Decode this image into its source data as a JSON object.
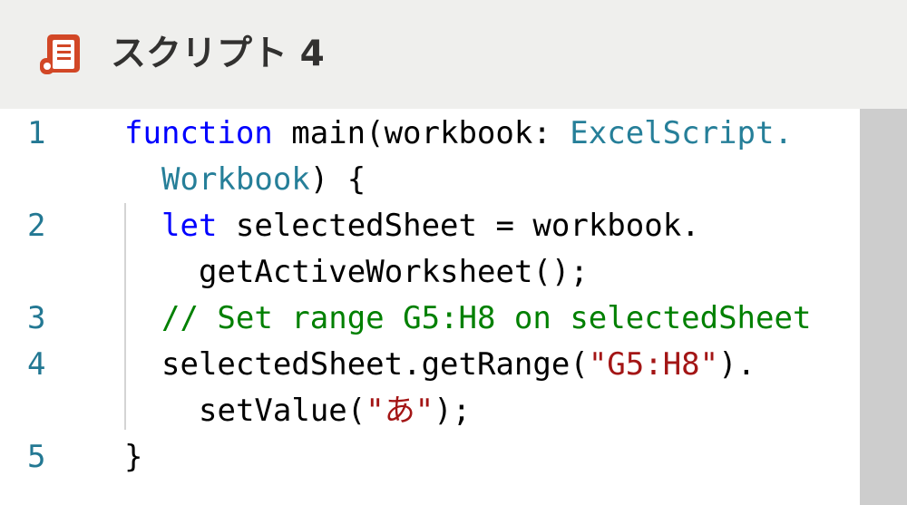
{
  "header": {
    "icon": "script-icon",
    "title": "スクリプト 4"
  },
  "colors": {
    "header_bg": "#efefed",
    "icon_orange": "#d24726",
    "keyword": "#0000ff",
    "type": "#267f99",
    "string": "#a31515",
    "comment": "#008000",
    "line_number": "#237893"
  },
  "editor": {
    "line_numbers": [
      "1",
      "2",
      "3",
      "4",
      "5"
    ],
    "code": {
      "l1_kw": "function",
      "l1_a": " main(workbook: ",
      "l1_ty": "ExcelScript.",
      "l1b_ty": "Workbook",
      "l1b_a": ") {",
      "l2_kw": "let",
      "l2_a": " selectedSheet = workbook.",
      "l2b_a": "getActiveWorksheet();",
      "l3_cm": "// Set range G5:H8 on selectedSheet",
      "l4_a": "selectedSheet.getRange(",
      "l4_str": "\"G5:H8\"",
      "l4_b": ").",
      "l4b_a": "setValue(",
      "l4b_str": "\"あ\"",
      "l4b_b": ");",
      "l5_a": "}"
    }
  }
}
